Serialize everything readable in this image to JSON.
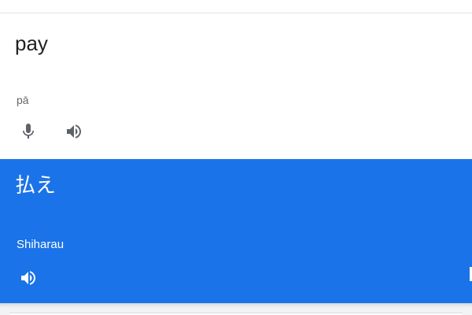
{
  "source": {
    "text": "pay",
    "transliteration": "pā",
    "mic_icon": "microphone-icon",
    "speaker_icon": "speaker-icon"
  },
  "target": {
    "text": "払え",
    "transliteration": "Shiharau",
    "speaker_icon": "speaker-icon"
  },
  "colors": {
    "accent": "#1a73e8",
    "source_text": "#222222",
    "secondary_text": "#666666",
    "background": "#f1f3f4",
    "icon_gray": "#5f6368"
  }
}
